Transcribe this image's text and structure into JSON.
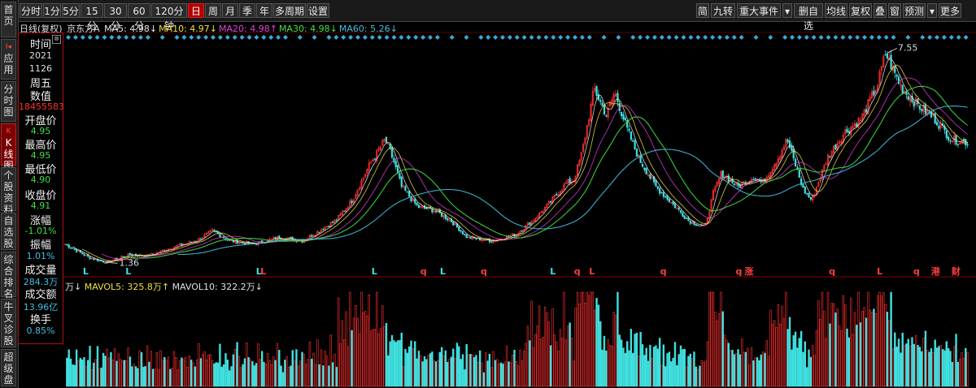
{
  "toolbar": {
    "periods": [
      "分时",
      "1分",
      "5分",
      "15分",
      "30分",
      "60分",
      "120分钟",
      "日",
      "周",
      "月",
      "季",
      "年",
      "多周期",
      "设置"
    ],
    "active_period": "日",
    "right_tools": [
      "简",
      "九转",
      "重大事件",
      "▾",
      "删自选",
      "均线",
      "复权",
      "叠",
      "窗",
      "预测",
      "▾",
      "更多"
    ]
  },
  "sidebar": {
    "items": [
      {
        "label": "首页",
        "marker": ""
      },
      {
        "label": "应用",
        "marker": "I◂"
      },
      {
        "label": "分时图",
        "marker": ""
      },
      {
        "label": "K线图",
        "marker": "K"
      },
      {
        "label": "个股资料",
        "marker": ""
      },
      {
        "label": "自选股",
        "marker": ""
      },
      {
        "label": "综合排名",
        "marker": ""
      },
      {
        "label": "牛叉诊股",
        "marker": ""
      },
      {
        "label": "超级盘",
        "marker": ""
      }
    ],
    "active": "K线图"
  },
  "legend": {
    "mode": "日线(复权)",
    "stock": "京东方A",
    "items": [
      {
        "text": "MA5: 4.98↓",
        "color": "#e8e8e8"
      },
      {
        "text": "MA10: 4.97↓",
        "color": "#f0e040"
      },
      {
        "text": "MA20: 4.98↑",
        "color": "#e040e0"
      },
      {
        "text": "MA30: 4.98↓",
        "color": "#40e040"
      },
      {
        "text": "MA60: 5.26↓",
        "color": "#40c0e0"
      }
    ]
  },
  "info": {
    "time_label": "时间",
    "year": "2021",
    "date": "1126",
    "weekday": "周五",
    "value_label": "数值",
    "value": "18455583",
    "open_label": "开盘价",
    "open": "4.95",
    "high_label": "最高价",
    "high": "4.95",
    "low_label": "最低价",
    "low": "4.90",
    "close_label": "收盘价",
    "close": "4.91",
    "chg_label": "涨幅",
    "chg": "-1.01%",
    "amp_label": "振幅",
    "amp": "1.01%",
    "vol_label": "成交量",
    "vol": "284.3万",
    "amt_label": "成交额",
    "amt": "13.96亿",
    "turn_label": "换手",
    "turn": "0.85%"
  },
  "volume_legend": {
    "prefix": "万↓",
    "mavol5": "MAVOL5: 325.8万↑",
    "mavol10": "MAVOL10: 322.2万↓"
  },
  "colors": {
    "up": "#ff3030",
    "down": "#40e0e0",
    "panel_border": "#b01010",
    "ma5": "#e8e8e8",
    "ma10": "#f0e040",
    "ma20": "#e040e0",
    "ma30": "#40e040",
    "ma60": "#40c0e0"
  },
  "annotations": {
    "high_label": "7.55",
    "low_label": "1.36",
    "events": [
      {
        "t": "L",
        "c": "#40e0e0",
        "p": 0.02
      },
      {
        "t": "L",
        "c": "#40e0e0",
        "p": 0.068
      },
      {
        "t": "L",
        "c": "#40e0e0",
        "p": 0.215
      },
      {
        "t": "L",
        "c": "#ff4040",
        "p": 0.22
      },
      {
        "t": "L",
        "c": "#40e0e0",
        "p": 0.345
      },
      {
        "t": "q",
        "c": "#ff4040",
        "p": 0.4
      },
      {
        "t": "L",
        "c": "#40e0e0",
        "p": 0.422
      },
      {
        "t": "q",
        "c": "#ff4040",
        "p": 0.468
      },
      {
        "t": "L",
        "c": "#40e0e0",
        "p": 0.546
      },
      {
        "t": "q",
        "c": "#ff4040",
        "p": 0.573
      },
      {
        "t": "L",
        "c": "#ff4040",
        "p": 0.59
      },
      {
        "t": "q",
        "c": "#ff4040",
        "p": 0.67
      },
      {
        "t": "q",
        "c": "#ff4040",
        "p": 0.755
      },
      {
        "t": "涨",
        "c": "#ff4040",
        "p": 0.765
      },
      {
        "t": "q",
        "c": "#ff4040",
        "p": 0.86
      },
      {
        "t": "L",
        "c": "#ff4040",
        "p": 0.914
      },
      {
        "t": "q",
        "c": "#ff4040",
        "p": 0.955
      },
      {
        "t": "港",
        "c": "#ff4040",
        "p": 0.975
      },
      {
        "t": "财",
        "c": "#ff4040",
        "p": 0.998
      }
    ]
  },
  "chart_data": {
    "type": "candlestick",
    "keypoints": [
      [
        0,
        1.9
      ],
      [
        0.03,
        1.5
      ],
      [
        0.05,
        1.36
      ],
      [
        0.08,
        1.6
      ],
      [
        0.1,
        1.55
      ],
      [
        0.13,
        1.8
      ],
      [
        0.16,
        2.0
      ],
      [
        0.18,
        2.3
      ],
      [
        0.2,
        2.0
      ],
      [
        0.23,
        1.9
      ],
      [
        0.26,
        2.1
      ],
      [
        0.29,
        2.0
      ],
      [
        0.31,
        2.3
      ],
      [
        0.33,
        2.6
      ],
      [
        0.35,
        3.2
      ],
      [
        0.37,
        4.2
      ],
      [
        0.39,
        5.0
      ],
      [
        0.4,
        4.4
      ],
      [
        0.41,
        3.6
      ],
      [
        0.43,
        3.0
      ],
      [
        0.45,
        2.9
      ],
      [
        0.47,
        2.6
      ],
      [
        0.49,
        2.1
      ],
      [
        0.52,
        2.0
      ],
      [
        0.55,
        2.2
      ],
      [
        0.57,
        2.6
      ],
      [
        0.59,
        3.1
      ],
      [
        0.61,
        3.7
      ],
      [
        0.62,
        3.8
      ],
      [
        0.63,
        4.6
      ],
      [
        0.645,
        6.5
      ],
      [
        0.66,
        5.7
      ],
      [
        0.67,
        6.4
      ],
      [
        0.685,
        5.3
      ],
      [
        0.7,
        4.4
      ],
      [
        0.72,
        3.6
      ],
      [
        0.74,
        3.1
      ],
      [
        0.76,
        2.6
      ],
      [
        0.78,
        2.4
      ],
      [
        0.79,
        3.4
      ],
      [
        0.8,
        4.0
      ],
      [
        0.82,
        3.6
      ],
      [
        0.84,
        3.9
      ],
      [
        0.85,
        3.7
      ],
      [
        0.87,
        4.5
      ],
      [
        0.88,
        5.0
      ],
      [
        0.9,
        3.5
      ],
      [
        0.91,
        3.2
      ],
      [
        0.93,
        4.5
      ],
      [
        0.95,
        5.2
      ],
      [
        0.97,
        5.6
      ],
      [
        0.99,
        6.6
      ],
      [
        1.0,
        7.55
      ],
      [
        1.02,
        6.5
      ],
      [
        1.04,
        6.0
      ],
      [
        1.06,
        5.6
      ],
      [
        1.08,
        5.0
      ],
      [
        1.1,
        4.91
      ]
    ],
    "ylim": [
      1.2,
      7.8
    ],
    "high": 7.55,
    "low": 1.36
  }
}
